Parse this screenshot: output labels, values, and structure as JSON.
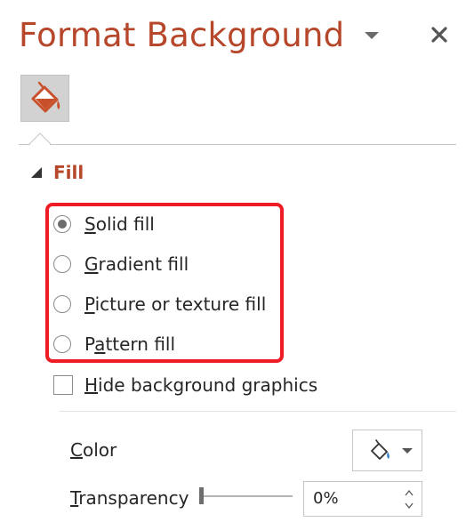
{
  "pane": {
    "title": "Format Background",
    "options_icon": "chevron-down-icon",
    "close_icon": "close-icon",
    "tab_icon": "paint-bucket-icon"
  },
  "fill": {
    "section_title": "Fill",
    "options": [
      {
        "pre": "",
        "key": "S",
        "post": "olid fill",
        "selected": true
      },
      {
        "pre": "",
        "key": "G",
        "post": "radient fill",
        "selected": false
      },
      {
        "pre": "",
        "key": "P",
        "post": "icture or texture fill",
        "selected": false
      },
      {
        "pre": "P",
        "key": "a",
        "post": "ttern fill",
        "selected": false
      }
    ],
    "hide_graphics": {
      "pre": "",
      "key": "H",
      "post": "ide background graphics",
      "checked": false
    }
  },
  "color": {
    "pre": "",
    "key": "C",
    "post": "olor",
    "swatch_icon": "paint-bucket-icon"
  },
  "transparency": {
    "pre": "",
    "key": "T",
    "post": "ransparency",
    "value": "0%",
    "level": 0
  },
  "colors": {
    "accent": "#b7472a",
    "highlight_border": "#ee1c24"
  }
}
